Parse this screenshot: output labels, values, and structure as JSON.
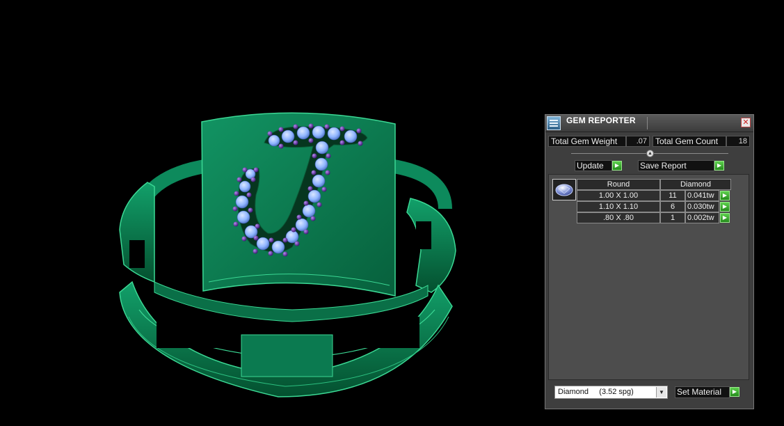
{
  "panel": {
    "title": "GEM REPORTER",
    "close_glyph": "✕",
    "total_gem_weight_label": "Total Gem Weight",
    "total_gem_weight_value": ".07",
    "total_gem_count_label": "Total Gem Count",
    "total_gem_count_value": "18",
    "update_label": "Update",
    "save_report_label": "Save Report",
    "table": {
      "shape_header": "Round",
      "material_header": "Diamond",
      "rows": [
        {
          "size": "1.00 X 1.00",
          "count": "11",
          "weight": "0.041tw"
        },
        {
          "size": "1.10 X 1.10",
          "count": "6",
          "weight": "0.030tw"
        },
        {
          "size": ".80 X .80",
          "count": "1",
          "weight": "0.002tw"
        }
      ]
    },
    "material_select_value": "Diamond     (3.52 spg)",
    "set_material_label": "Set Material"
  },
  "colors": {
    "ring_green": "#0d8a5c",
    "gem_blue": "#8fb5ff",
    "prong_purple": "#5b1f9a",
    "button_green": "#2fa526"
  },
  "icons": {
    "app": "gem-reporter-app-icon",
    "close": "close-icon",
    "arrow": "green-play-arrow-icon",
    "collapse": "collapse-arrow-icon",
    "dropdown": "dropdown-arrow-icon",
    "gem": "round-diamond-gem-icon"
  }
}
